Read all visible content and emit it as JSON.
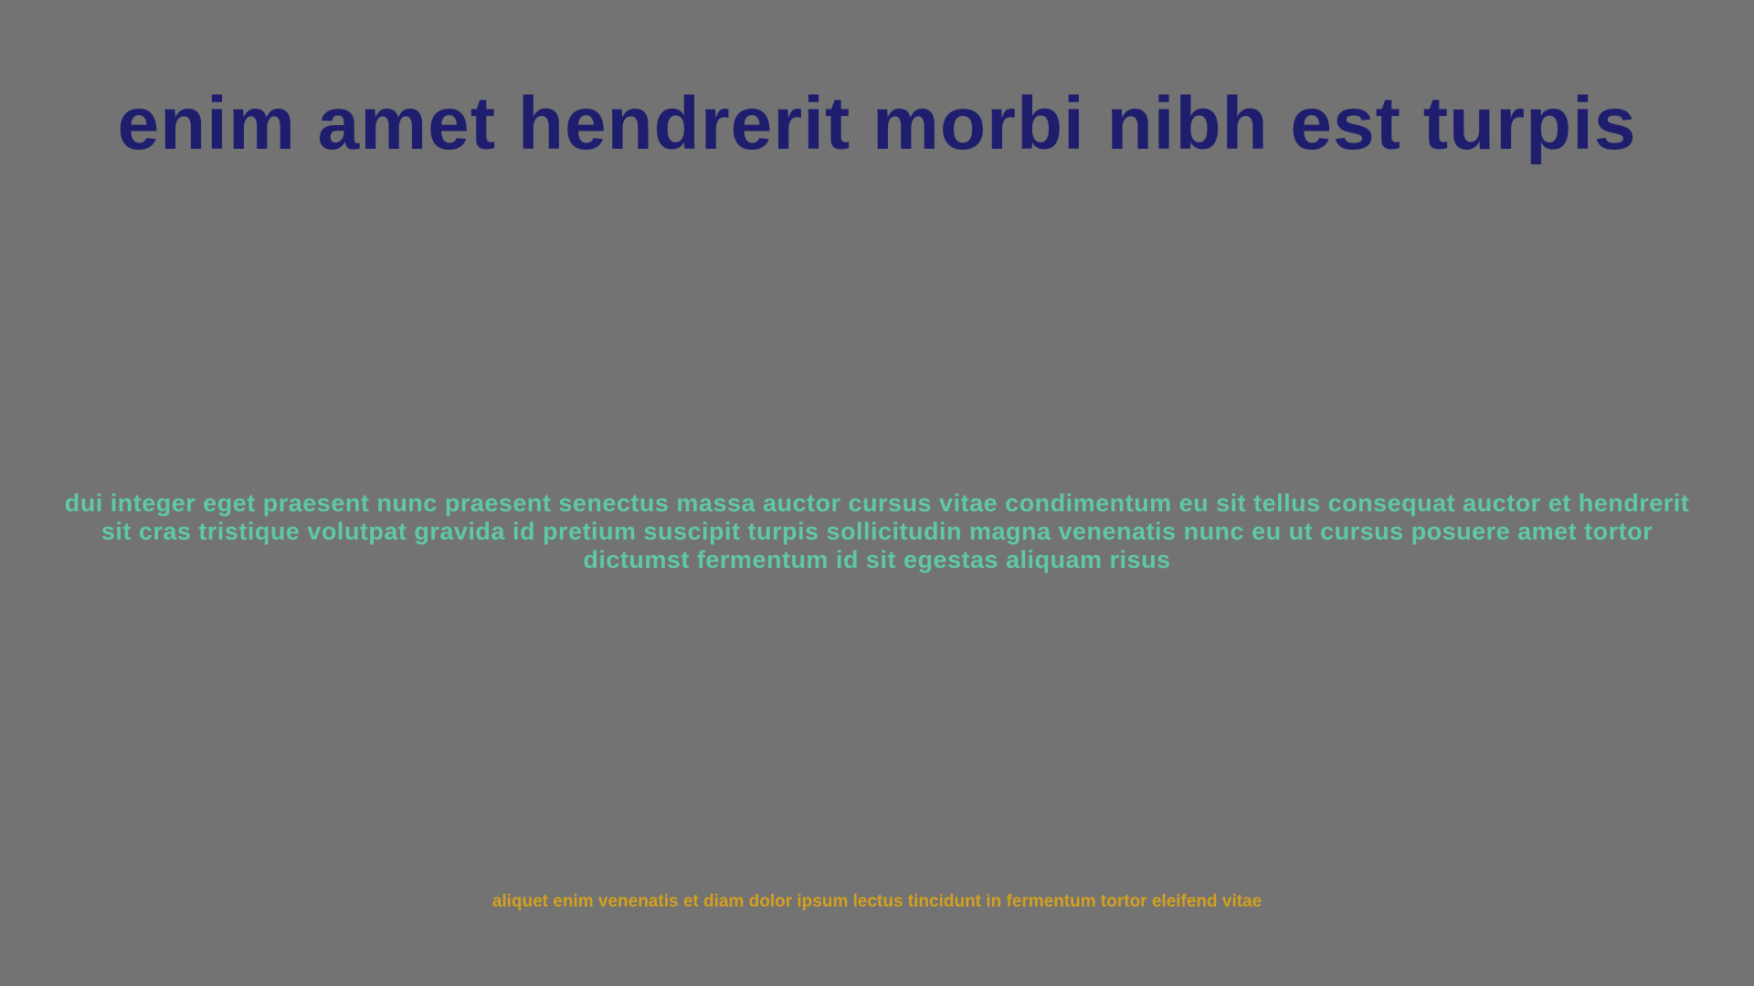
{
  "slide": {
    "title": "enim amet hendrerit morbi nibh est turpis",
    "body": "dui integer eget praesent nunc praesent senectus massa auctor cursus vitae condimentum eu sit tellus consequat auctor et hendrerit sit cras tristique volutpat gravida id pretium suscipit turpis sollicitudin magna venenatis nunc eu ut cursus posuere amet tortor dictumst fermentum id sit egestas aliquam risus",
    "footer": "aliquet enim venenatis et diam dolor ipsum lectus tincidunt in fermentum tortor eleifend vitae"
  },
  "colors": {
    "background": "#737373",
    "title": "#1f1d6e",
    "body": "#5fc8a4",
    "footer": "#d4a01e"
  }
}
